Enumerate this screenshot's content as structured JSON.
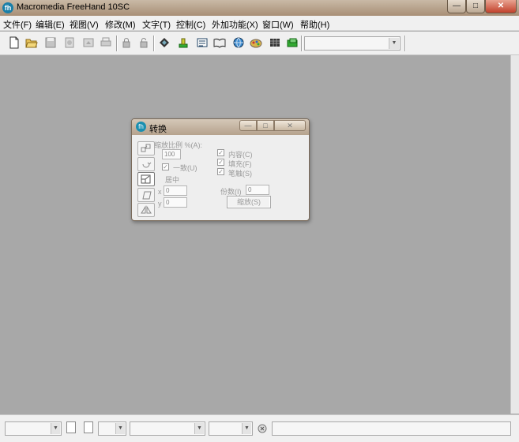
{
  "window": {
    "title": "Macromedia FreeHand 10SC",
    "app_icon_label": "fh"
  },
  "window_controls": {
    "minimize": "—",
    "maximize": "□",
    "close": "✕"
  },
  "menu": [
    "文件(F)",
    "编辑(E)",
    "视图(V)",
    "修改(M)",
    "文字(T)",
    "控制(C)",
    "外加功能(X)",
    "窗口(W)",
    "帮助(H)"
  ],
  "toolbar": {
    "icons": [
      "new-document-icon",
      "open-folder-icon",
      "save-icon",
      "import-icon",
      "export-icon",
      "print-icon",
      "lock-icon",
      "unlock-icon",
      "layers-icon",
      "stamp-icon",
      "text-block-icon",
      "library-icon",
      "globe-icon",
      "swatches-icon",
      "grid-icon",
      "links-icon"
    ],
    "combo_value": ""
  },
  "dialog": {
    "title": "转换",
    "icon_label": "fh",
    "controls": {
      "minimize": "—",
      "maximize": "□",
      "close": "✕"
    },
    "scale_label": "缩放比例 %(A):",
    "scale_value": "100",
    "uniform_label": "一致(U)",
    "uniform_checked": true,
    "center_label": "居中",
    "x_label": "x",
    "x_value": "0",
    "y_label": "y",
    "y_value": "0",
    "contents_label": "内容(C)",
    "fills_label": "填充(F)",
    "strokes_label": "笔触(S)",
    "copies_label": "份数(I)",
    "copies_value": "0",
    "scale_button": "缩放(S)",
    "side_icons": [
      "move-icon",
      "rotate-icon",
      "scale-icon",
      "skew-icon",
      "reflect-icon"
    ]
  },
  "statusbar": {
    "field_value": ""
  }
}
